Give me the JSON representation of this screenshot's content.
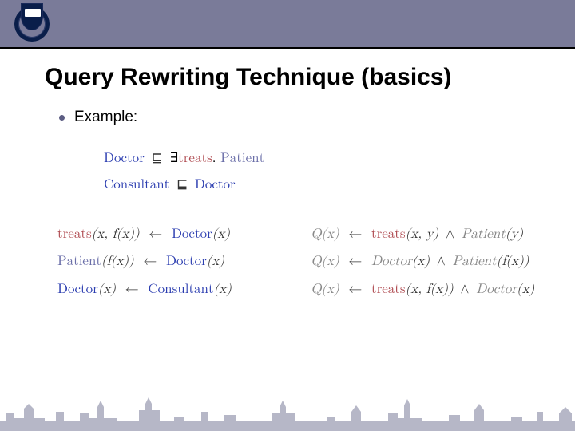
{
  "header": {
    "title": "Query Rewriting Technique (basics)"
  },
  "bullet": {
    "label": "Example:"
  },
  "axioms": {
    "a1": {
      "lhs_concept": "Doctor",
      "sub": "⊑",
      "rhs_exists": "∃",
      "rhs_role": "treats",
      "rhs_dot": ".",
      "rhs_concept": "Patient"
    },
    "a2": {
      "lhs_concept": "Consultant",
      "sub": "⊑",
      "rhs_concept": "Doctor"
    }
  },
  "rules_left": [
    {
      "head_role": "treats",
      "head_args": "(x, f(x))",
      "arrow": "←",
      "body_concept": "Doctor",
      "body_args": "(x)"
    },
    {
      "head_concept": "Patient",
      "head_args": "(f(x))",
      "arrow": "←",
      "body_concept": "Doctor",
      "body_args": "(x)"
    },
    {
      "head_concept": "Doctor",
      "head_args": "(x)",
      "arrow": "←",
      "body_concept": "Consultant",
      "body_args": "(x)"
    }
  ],
  "rules_right": [
    {
      "q": "Q(x)",
      "arrow": "←",
      "p1_role": "treats",
      "p1_args": "(x, y)",
      "conj": "∧",
      "p2_concept": "Patient",
      "p2_args": "(y)"
    },
    {
      "q": "Q(x)",
      "arrow": "←",
      "p1_concept": "Doctor",
      "p1_args": "(x)",
      "conj": "∧",
      "p2_concept": "Patient",
      "p2_args": "(f(x))"
    },
    {
      "q": "Q(x)",
      "arrow": "←",
      "p1_role": "treats",
      "p1_args": "(x, f(x))",
      "conj": "∧",
      "p2_concept": "Doctor",
      "p2_args": "(x)"
    }
  ],
  "colors": {
    "header_bar": "#7a7b99",
    "concept": "#2b3db0",
    "role": "#b04c52",
    "faded_concept": "#6a6ea8",
    "skyline": "#7a7b99"
  }
}
